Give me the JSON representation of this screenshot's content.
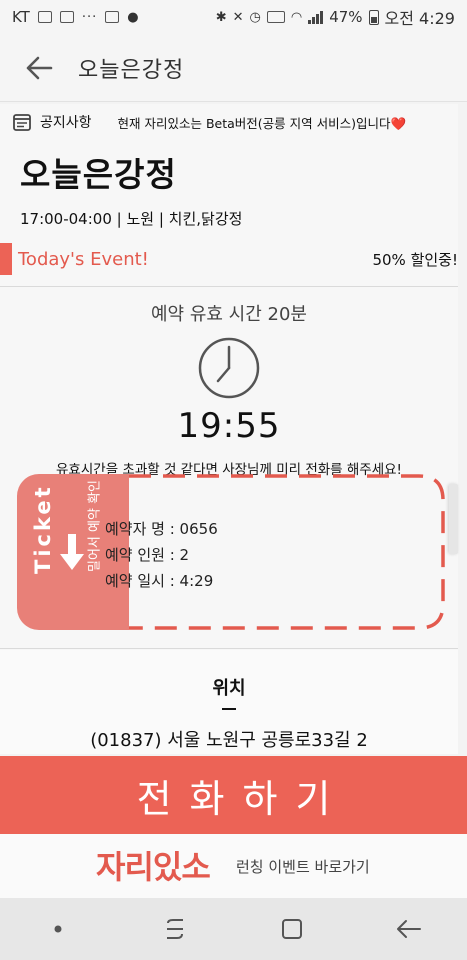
{
  "status_bar": {
    "carrier": "KT",
    "more": "···",
    "battery": "47%",
    "time": "오전 4:29"
  },
  "header": {
    "title": "오늘은강정"
  },
  "notice": {
    "label": "공지사항",
    "text": "현재 자리있소는 Beta버전(공릉 지역 서비스)입니다❤️"
  },
  "store": {
    "name": "오늘은강정",
    "info": "17:00-04:00 | 노원 | 치킨,닭강정"
  },
  "event": {
    "title": "Today's Event!",
    "discount": "50% 할인중!"
  },
  "reservation": {
    "expiry_label": "예약 유효 시간 20분",
    "timer": "19:55",
    "message": "유효시간을 초과할 것 같다면 사장님께 미리 전화를 해주세요!"
  },
  "ticket": {
    "word": "Ticket",
    "swipe_hint": "밀어서 예약 확인",
    "lines": [
      "예약자 명 : 0656",
      "예약 인원 : 2",
      "예약 일시 : 4:29"
    ],
    "accent_color": "#e88078"
  },
  "location": {
    "title": "위치",
    "address": "(01837) 서울 노원구 공릉로33길 2"
  },
  "call_button": {
    "label": "전화하기"
  },
  "footer": {
    "brand": "자리있소",
    "link": "런칭 이벤트 바로가기"
  },
  "colors": {
    "accent": "#ec6356",
    "background": "#f3f3f3"
  }
}
